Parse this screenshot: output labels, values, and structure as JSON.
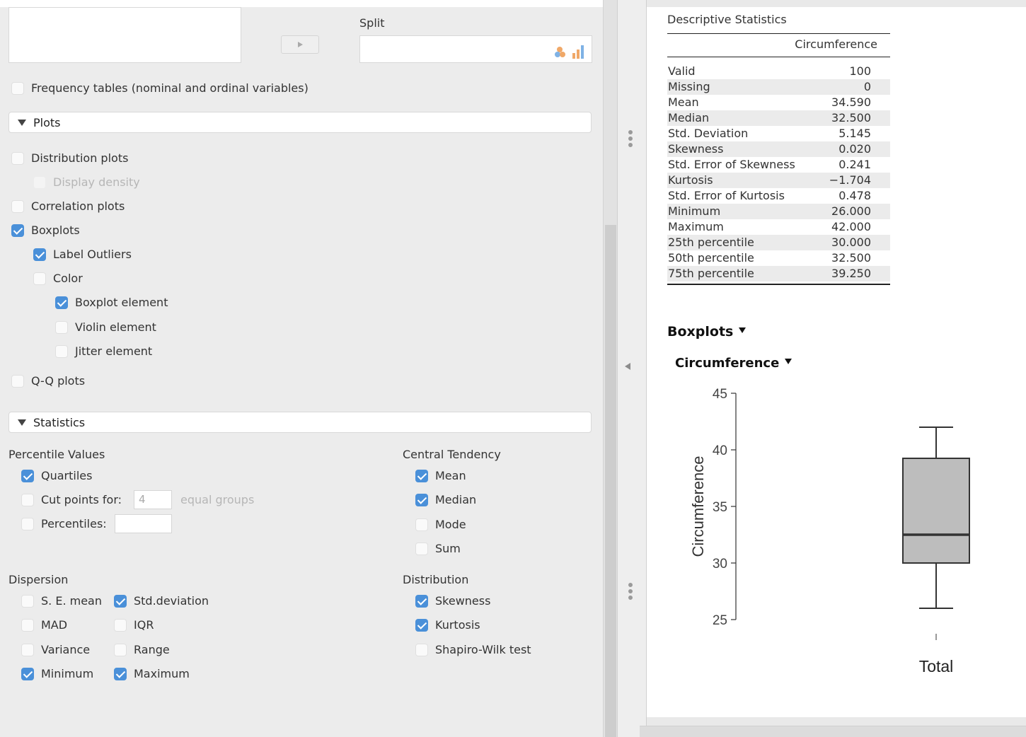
{
  "variables": {
    "split_label": "Split"
  },
  "frequency_tables": {
    "label": "Frequency tables (nominal and ordinal variables)",
    "checked": false
  },
  "plots": {
    "title": "Plots",
    "options": [
      {
        "key": "distribution_plots",
        "label": "Distribution plots",
        "checked": false,
        "disabled": false,
        "indent": 0
      },
      {
        "key": "display_density",
        "label": "Display density",
        "checked": false,
        "disabled": true,
        "indent": 1
      },
      {
        "key": "correlation_plots",
        "label": "Correlation plots",
        "checked": false,
        "disabled": false,
        "indent": 0
      },
      {
        "key": "boxplots",
        "label": "Boxplots",
        "checked": true,
        "disabled": false,
        "indent": 0
      },
      {
        "key": "label_outliers",
        "label": "Label Outliers",
        "checked": true,
        "disabled": false,
        "indent": 1
      },
      {
        "key": "color",
        "label": "Color",
        "checked": false,
        "disabled": false,
        "indent": 1
      },
      {
        "key": "boxplot_element",
        "label": "Boxplot element",
        "checked": true,
        "disabled": false,
        "indent": 2
      },
      {
        "key": "violin_element",
        "label": "Violin element",
        "checked": false,
        "disabled": false,
        "indent": 2
      },
      {
        "key": "jitter_element",
        "label": "Jitter element",
        "checked": false,
        "disabled": false,
        "indent": 2
      },
      {
        "key": "qq_plots",
        "label": "Q-Q plots",
        "checked": false,
        "disabled": false,
        "indent": 0
      }
    ]
  },
  "statistics": {
    "title": "Statistics",
    "percentile_values": {
      "title": "Percentile Values",
      "quartiles": {
        "label": "Quartiles",
        "checked": true
      },
      "cut_points": {
        "label": "Cut points for:",
        "checked": false,
        "value": "4",
        "suffix": "equal groups"
      },
      "percentiles": {
        "label": "Percentiles:",
        "checked": false,
        "value": ""
      }
    },
    "central_tendency": {
      "title": "Central Tendency",
      "items": [
        {
          "label": "Mean",
          "checked": true
        },
        {
          "label": "Median",
          "checked": true
        },
        {
          "label": "Mode",
          "checked": false
        },
        {
          "label": "Sum",
          "checked": false
        }
      ]
    },
    "dispersion": {
      "title": "Dispersion",
      "items": [
        {
          "label": "S. E. mean",
          "checked": false
        },
        {
          "label": "Std.deviation",
          "checked": true
        },
        {
          "label": "MAD",
          "checked": false
        },
        {
          "label": "IQR",
          "checked": false
        },
        {
          "label": "Variance",
          "checked": false
        },
        {
          "label": "Range",
          "checked": false
        },
        {
          "label": "Minimum",
          "checked": true
        },
        {
          "label": "Maximum",
          "checked": true
        }
      ]
    },
    "distribution": {
      "title": "Distribution",
      "items": [
        {
          "label": "Skewness",
          "checked": true
        },
        {
          "label": "Kurtosis",
          "checked": true
        },
        {
          "label": "Shapiro-Wilk test",
          "checked": false
        }
      ]
    }
  },
  "results": {
    "table_title": "Descriptive Statistics",
    "column": "Circumference",
    "rows": [
      {
        "name": "Valid",
        "value": "100"
      },
      {
        "name": "Missing",
        "value": "0"
      },
      {
        "name": "Mean",
        "value": "34.590"
      },
      {
        "name": "Median",
        "value": "32.500"
      },
      {
        "name": "Std. Deviation",
        "value": "5.145"
      },
      {
        "name": "Skewness",
        "value": "0.020"
      },
      {
        "name": "Std. Error of Skewness",
        "value": "0.241"
      },
      {
        "name": "Kurtosis",
        "value": "−1.704"
      },
      {
        "name": "Std. Error of Kurtosis",
        "value": "0.478"
      },
      {
        "name": "Minimum",
        "value": "26.000"
      },
      {
        "name": "Maximum",
        "value": "42.000"
      },
      {
        "name": "25th percentile",
        "value": "30.000"
      },
      {
        "name": "50th percentile",
        "value": "32.500"
      },
      {
        "name": "75th percentile",
        "value": "39.250"
      }
    ],
    "boxplots_title": "Boxplots",
    "plot_title": "Circumference"
  },
  "chart_data": {
    "type": "boxplot",
    "categories": [
      "Total"
    ],
    "ylabel": "Circumference",
    "ylim": [
      25,
      45
    ],
    "yticks": [
      25,
      30,
      35,
      40,
      45
    ],
    "boxes": [
      {
        "category": "Total",
        "min": 26,
        "q1": 30,
        "median": 32.5,
        "q3": 39.25,
        "max": 42
      }
    ],
    "box_color": "#bdbdbd"
  },
  "colors": {
    "accent": "#4a90d9"
  }
}
